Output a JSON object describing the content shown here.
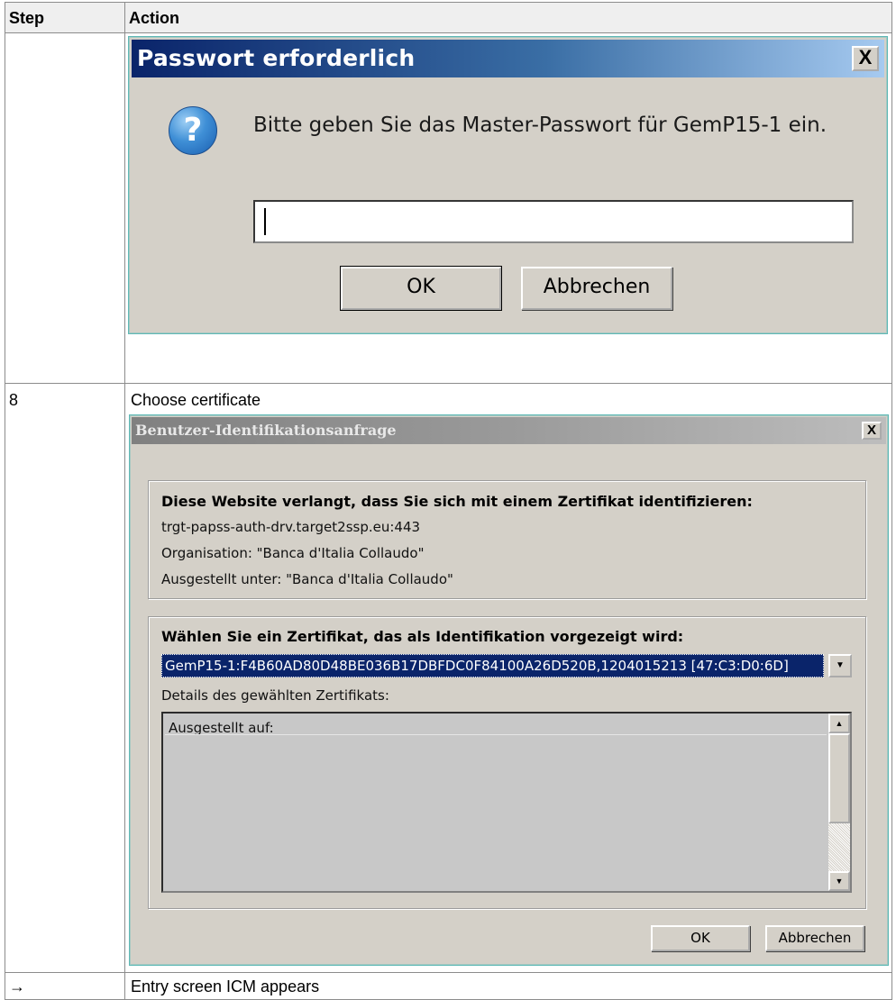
{
  "table": {
    "col_step": "Step",
    "col_action": "Action",
    "rows": [
      {
        "step": "",
        "action": ""
      },
      {
        "step": "8",
        "action": "Choose certificate"
      },
      {
        "step": "→",
        "action": "Entry screen ICM appears"
      }
    ]
  },
  "password_dialog": {
    "title": "Passwort erforderlich",
    "close_label": "X",
    "icon": "question-icon",
    "icon_glyph": "?",
    "message": "Bitte geben Sie das Master-Passwort für GemP15-1 ein.",
    "password_value": "",
    "ok_label": "OK",
    "cancel_label": "Abbrechen"
  },
  "cert_dialog": {
    "title": "Benutzer-Identifikationsanfrage",
    "close_label": "X",
    "site_heading": "Diese Website verlangt, dass Sie sich mit einem Zertifikat identifizieren:",
    "site_host": "trgt-papss-auth-drv.target2ssp.eu:443",
    "organisation": "Organisation: \"Banca d'Italia Collaudo\"",
    "issued_under": "Ausgestellt unter: \"Banca d'Italia Collaudo\"",
    "choose_heading": "Wählen Sie ein Zertifikat, das als Identifikation vorgezeigt wird:",
    "selected_certificate": "GemP15-1:F4B60AD80D48BE036B17DBFDC0F84100A26D520B,1204015213 [47:C3:D0:6D]",
    "details_label": "Details des gewählten Zertifikats:",
    "details_text": "Ausgestellt auf:",
    "ok_label": "OK",
    "cancel_label": "Abbrechen"
  }
}
